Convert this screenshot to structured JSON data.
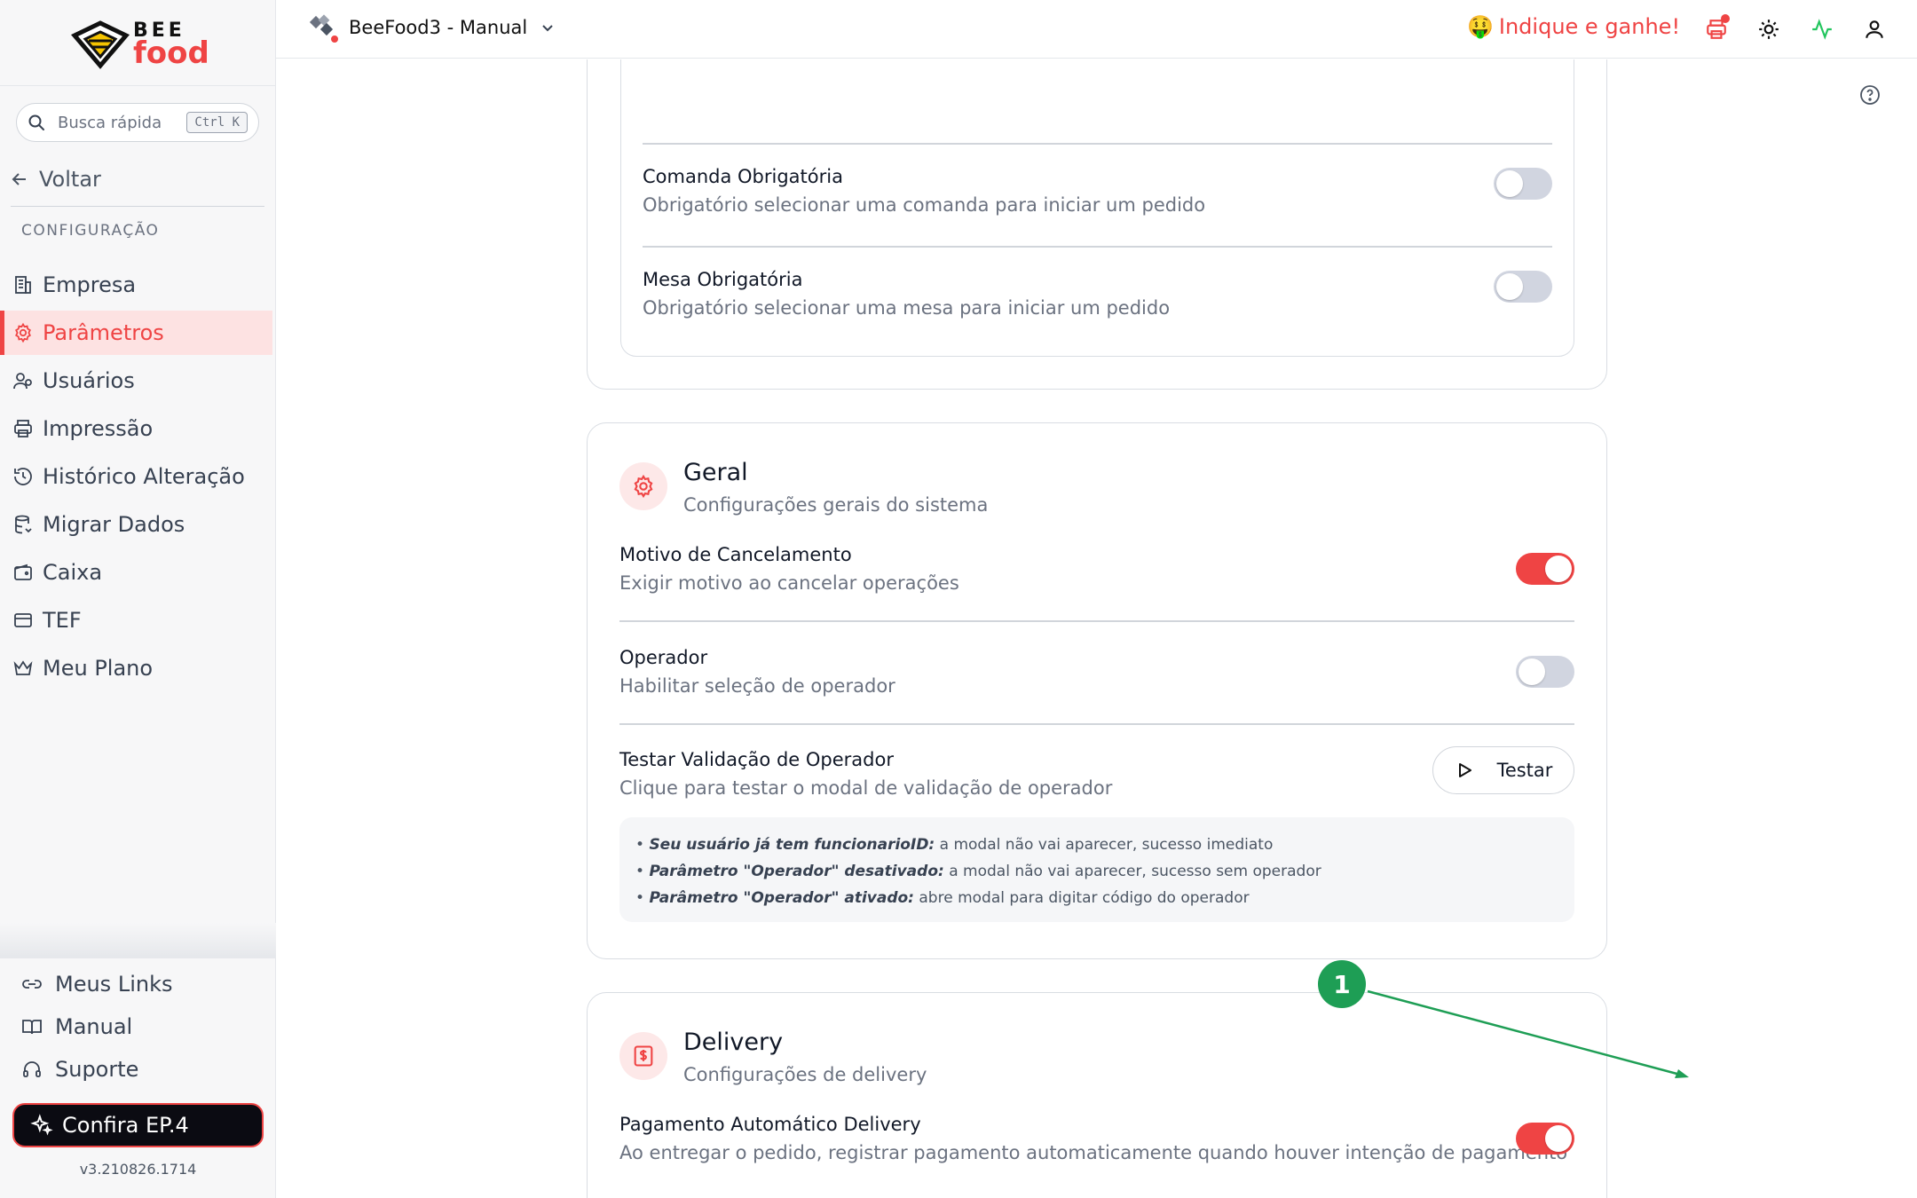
{
  "sidebar": {
    "logo": {
      "line1": "BEE",
      "line2": "food"
    },
    "search": {
      "placeholder": "Busca rápida",
      "shortcut": "Ctrl K"
    },
    "back_label": "Voltar",
    "section_title": "CONFIGURAÇÃO",
    "items": [
      {
        "label": "Empresa",
        "icon": "building-icon"
      },
      {
        "label": "Parâmetros",
        "icon": "gear-icon",
        "active": true
      },
      {
        "label": "Usuários",
        "icon": "users-icon"
      },
      {
        "label": "Impressão",
        "icon": "printer-icon"
      },
      {
        "label": "Histórico Alteração",
        "icon": "history-icon"
      },
      {
        "label": "Migrar Dados",
        "icon": "database-icon"
      },
      {
        "label": "Caixa",
        "icon": "wallet-icon"
      },
      {
        "label": "TEF",
        "icon": "card-icon"
      },
      {
        "label": "Meu Plano",
        "icon": "crown-icon"
      }
    ],
    "bottom_links": [
      {
        "label": "Meus Links",
        "icon": "link-icon"
      },
      {
        "label": "Manual",
        "icon": "book-icon"
      },
      {
        "label": "Suporte",
        "icon": "headset-icon"
      }
    ],
    "promo_label": "Confira EP.4",
    "version": "v3.210826.1714"
  },
  "header": {
    "company_name": "BeeFood3 - Manual",
    "refer_label": "Indique e ganhe!",
    "refer_emoji": "🤑"
  },
  "main": {
    "top_card": {
      "rows": [
        {
          "title": "Comanda Obrigatória",
          "desc": "Obrigatório selecionar uma comanda para iniciar um pedido",
          "enabled": false
        },
        {
          "title": "Mesa Obrigatória",
          "desc": "Obrigatório selecionar uma mesa para iniciar um pedido",
          "enabled": false
        }
      ]
    },
    "geral": {
      "title": "Geral",
      "subtitle": "Configurações gerais do sistema",
      "rows": [
        {
          "title": "Motivo de Cancelamento",
          "desc": "Exigir motivo ao cancelar operações",
          "enabled": true
        },
        {
          "title": "Operador",
          "desc": "Habilitar seleção de operador",
          "enabled": false
        },
        {
          "title": "Testar Validação de Operador",
          "desc": "Clique para testar o modal de validação de operador"
        }
      ],
      "test_button": "Testar",
      "info": [
        {
          "bold": "Seu usuário já tem funcionarioID:",
          "text": " a modal não vai aparecer, sucesso imediato"
        },
        {
          "bold": "Parâmetro \"Operador\" desativado:",
          "text": " a modal não vai aparecer, sucesso sem operador"
        },
        {
          "bold": "Parâmetro \"Operador\" ativado:",
          "text": " abre modal para digitar código do operador"
        }
      ]
    },
    "delivery": {
      "title": "Delivery",
      "subtitle": "Configurações de delivery",
      "rows": [
        {
          "title": "Pagamento Automático Delivery",
          "desc": "Ao entregar o pedido, registrar pagamento automaticamente quando houver intenção de pagamento",
          "enabled": true
        }
      ]
    }
  },
  "annotation": {
    "number": "1",
    "color": "#1e9e55"
  },
  "colors": {
    "accent": "#ef4444",
    "toggle_off": "#d1d5e0",
    "active_bg": "#fde2e2"
  }
}
